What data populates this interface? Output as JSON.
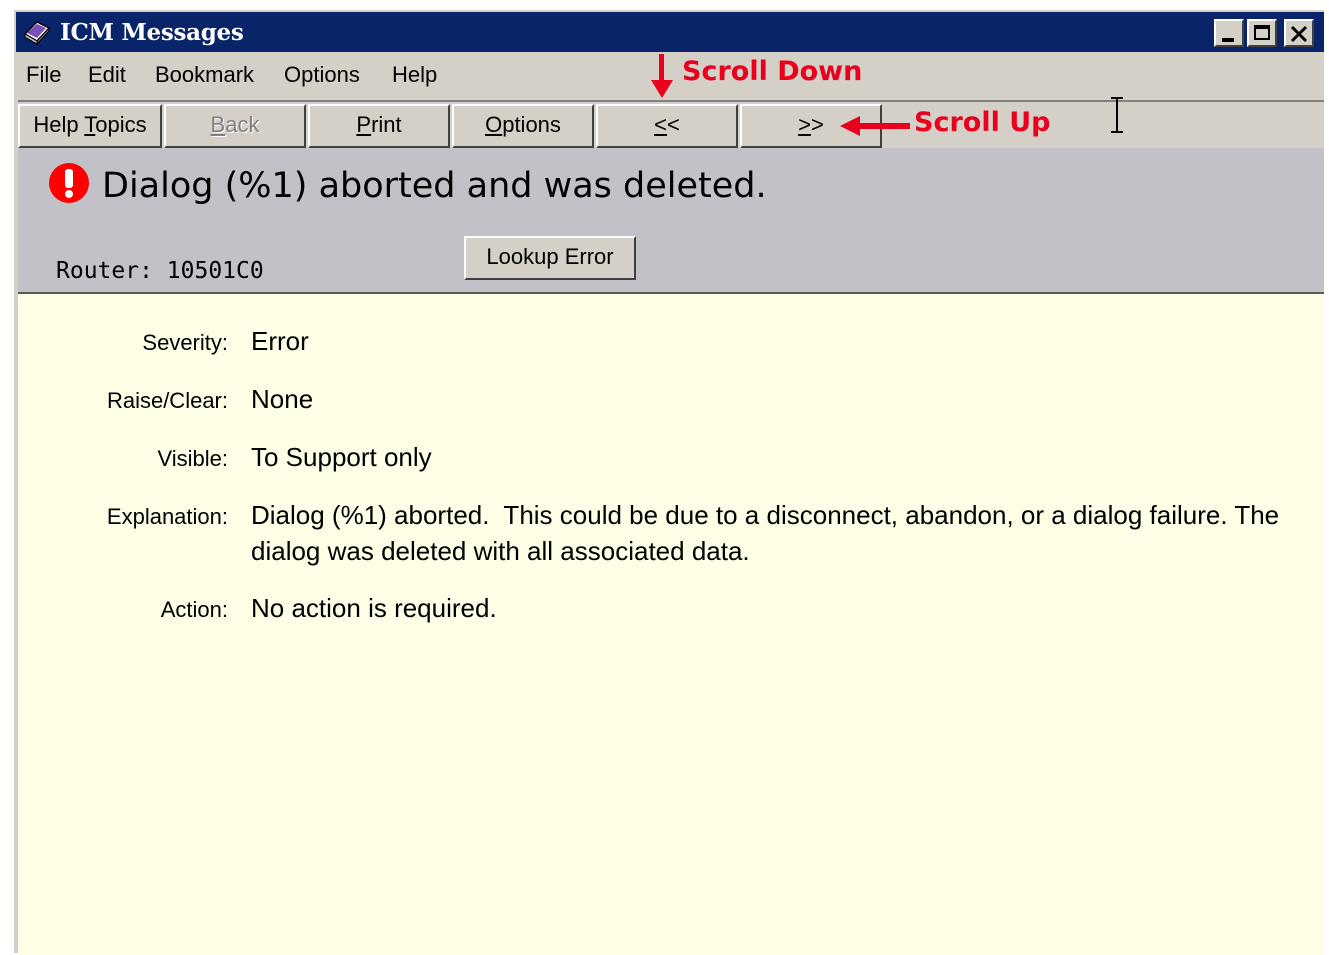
{
  "window": {
    "title": "ICM Messages",
    "controls": [
      "minimize",
      "maximize",
      "close"
    ]
  },
  "menu": [
    "File",
    "Edit",
    "Bookmark",
    "Options",
    "Help"
  ],
  "toolbar": {
    "help_topics": {
      "pre": "Help ",
      "ul": "T",
      "post": "opics"
    },
    "back": {
      "pre": "",
      "ul": "B",
      "post": "ack",
      "disabled": true
    },
    "print": {
      "pre": "",
      "ul": "P",
      "post": "rint"
    },
    "options": {
      "pre": "",
      "ul": "O",
      "post": "ptions"
    },
    "prev": {
      "pre": "",
      "ul": "<",
      "post": "<"
    },
    "next": {
      "pre": "",
      "ul": ">",
      "post": ">"
    }
  },
  "annotations": {
    "scroll_down": "Scroll Down",
    "scroll_up": "Scroll Up",
    "color": "#e8001c"
  },
  "message": {
    "headline": "Dialog (%1) aborted and was deleted.",
    "router": "Router: 10501C0",
    "lookup_button": "Lookup Error",
    "icon": "error-icon"
  },
  "details": {
    "severity_label": "Severity:",
    "severity": "Error",
    "raise_clear_label": "Raise/Clear:",
    "raise_clear": "None",
    "visible_label": "Visible:",
    "visible": "To Support only",
    "explanation_label": "Explanation:",
    "explanation": "Dialog (%1) aborted.  This could be due to a disconnect, abandon, or a dialog failure. The dialog was deleted with all associated data.",
    "action_label": "Action:",
    "action": "No action is required."
  }
}
